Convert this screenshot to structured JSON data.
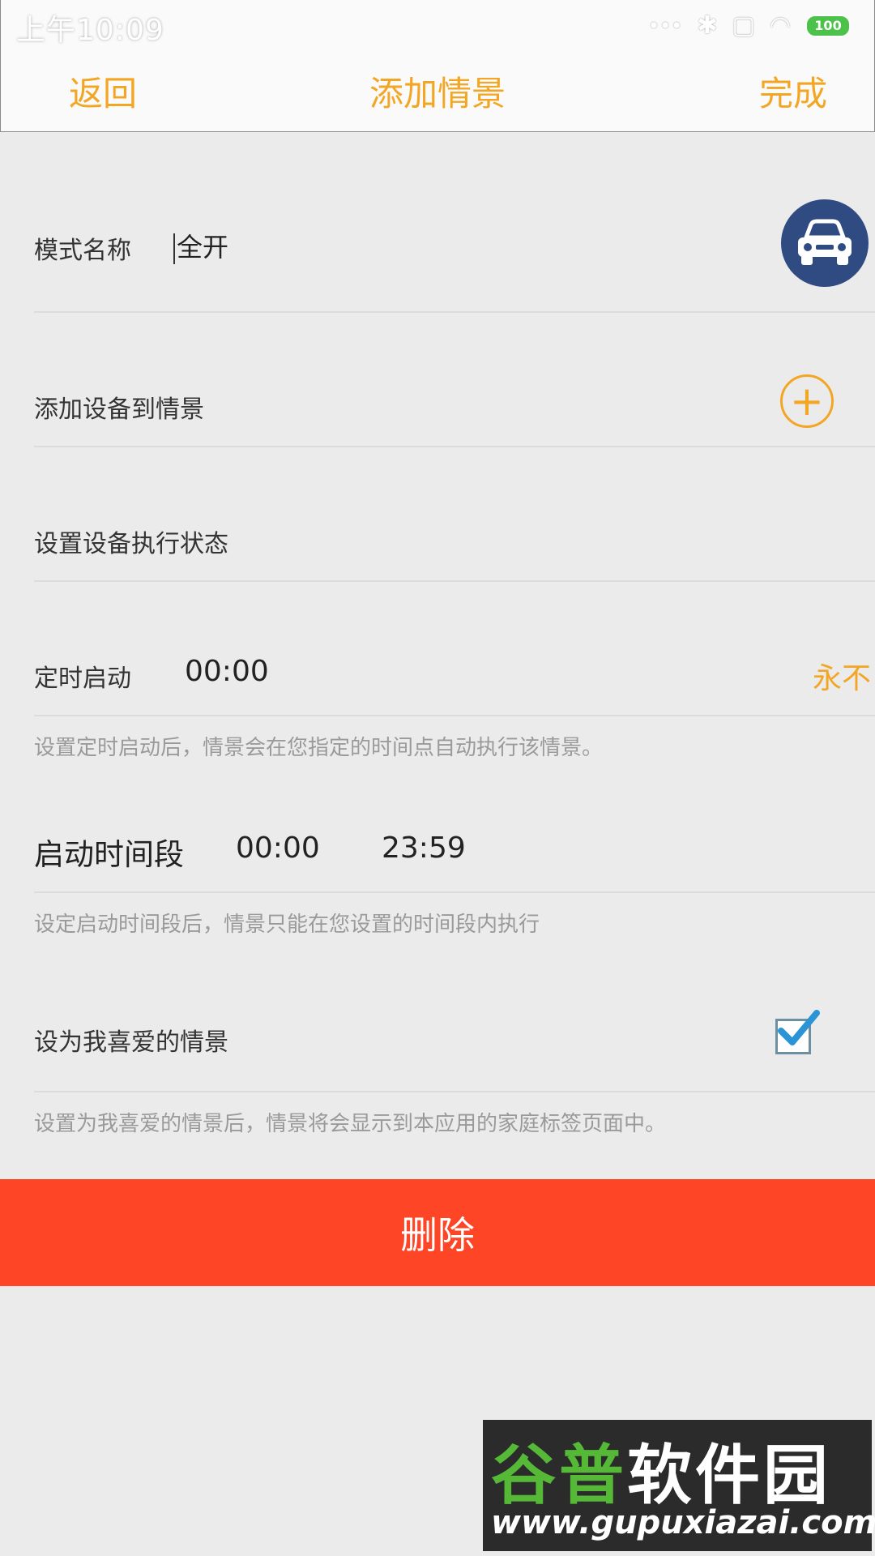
{
  "status_bar": {
    "time": "上午10:09",
    "battery": "100"
  },
  "nav": {
    "back": "返回",
    "title": "添加情景",
    "done": "完成"
  },
  "mode_name": {
    "label": "模式名称",
    "value": "全开",
    "icon": "car-icon"
  },
  "add_device": {
    "label": "添加设备到情景",
    "icon": "plus-circle-icon"
  },
  "device_state": {
    "label": "设置设备执行状态"
  },
  "timer": {
    "label": "定时启动",
    "time": "00:00",
    "repeat": "永不",
    "hint": "设置定时启动后，情景会在您指定的时间点自动执行该情景。"
  },
  "period": {
    "label": "启动时间段",
    "start": "00:00",
    "end": "23:59",
    "hint": "设定启动时间段后，情景只能在您设置的时间段内执行"
  },
  "favorite": {
    "label": "设为我喜爱的情景",
    "checked": true,
    "hint": "设置为我喜爱的情景后，情景将会显示到本应用的家庭标签页面中。"
  },
  "delete_button": "删除",
  "watermark": {
    "cn_green": "谷普",
    "cn_white": "软件园",
    "url": "www.gupuxiazai.com"
  },
  "colors": {
    "accent": "#f3a623",
    "danger": "#fe4526",
    "avatar_bg": "#2f4b82",
    "checkmark": "#2a94d6"
  }
}
